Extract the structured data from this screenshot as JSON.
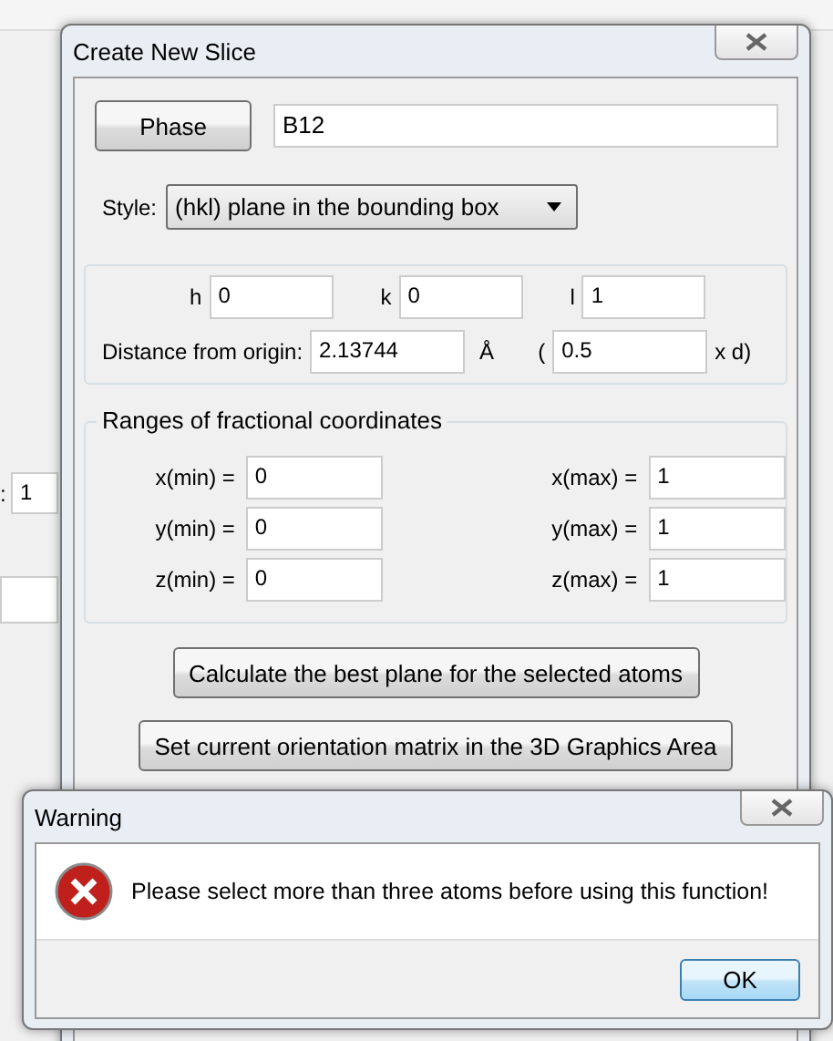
{
  "background_window": {
    "field_label": ":",
    "field_value": "1"
  },
  "dialog": {
    "title": "Create New Slice",
    "phase_button": "Phase",
    "phase_value": "B12",
    "style_label": "Style:",
    "style_value": "(hkl) plane in the bounding box",
    "hkl": [
      {
        "label": "h",
        "value": "0"
      },
      {
        "label": "k",
        "value": "0"
      },
      {
        "label": "l",
        "value": "1"
      }
    ],
    "distance_label": "Distance from origin:",
    "distance_value": "2.13744",
    "distance_unit": "Å",
    "d_open": "(",
    "d_factor": "0.5",
    "d_close": "x d)",
    "ranges_title": "Ranges of fractional coordinates",
    "ranges": [
      {
        "min_label": "x(min) =",
        "min_value": "0",
        "max_label": "x(max) =",
        "max_value": "1"
      },
      {
        "min_label": "y(min) =",
        "min_value": "0",
        "max_label": "y(max) =",
        "max_value": "1"
      },
      {
        "min_label": "z(min) =",
        "min_value": "0",
        "max_label": "z(max) =",
        "max_value": "1"
      }
    ],
    "buttons": [
      "Calculate the best plane for the selected atoms",
      "Set current orientation matrix in the 3D Graphics Area"
    ]
  },
  "warning": {
    "title": "Warning",
    "message": "Please select more than three atoms before using this function!",
    "button": "OK"
  }
}
